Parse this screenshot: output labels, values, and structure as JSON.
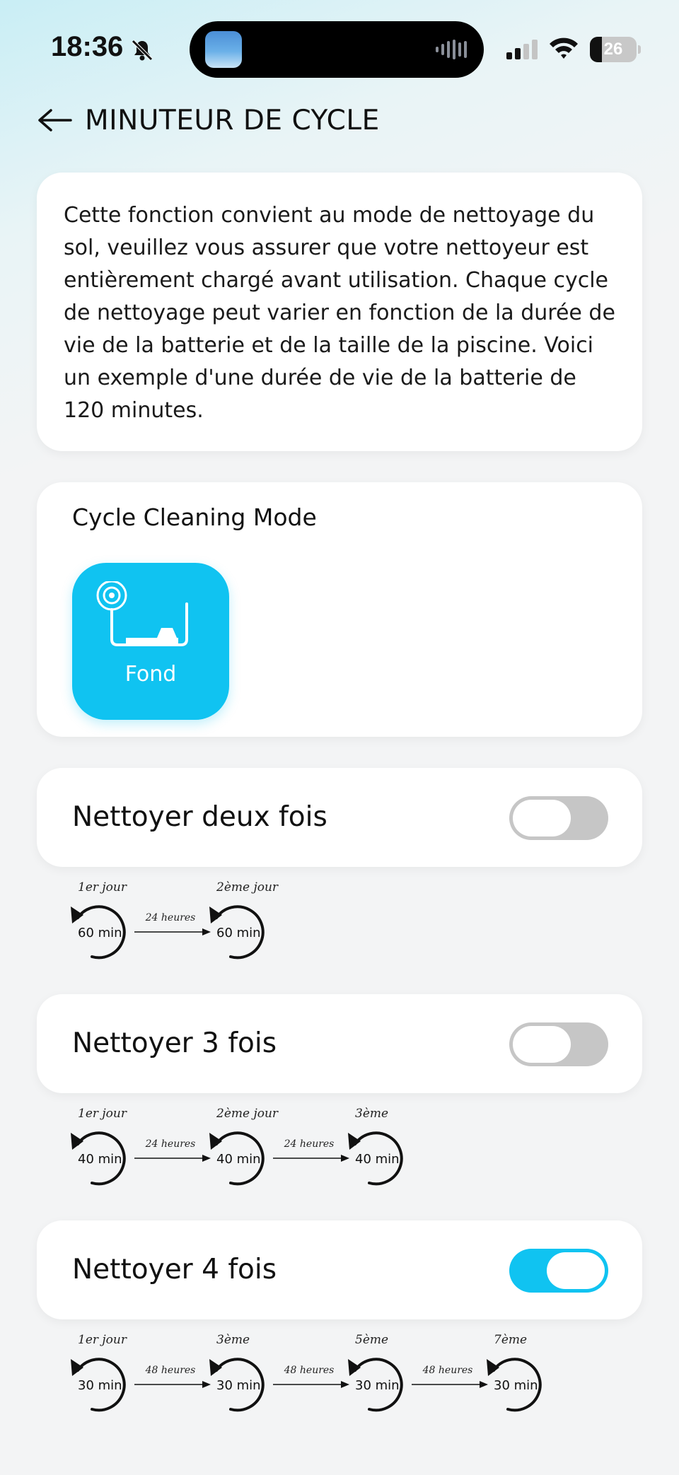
{
  "status_bar": {
    "time": "18:36",
    "battery": "26",
    "battery_level": 0.26
  },
  "header": {
    "title": "MINUTEUR DE CYCLE"
  },
  "info": {
    "text": "Cette fonction convient au mode de nettoyage du sol, veuillez vous assurer que votre nettoyeur est entièrement chargé avant utilisation. Chaque cycle de nettoyage peut varier en fonction de la durée de vie de la batterie et de la taille de la piscine. Voici un exemple d'une durée de vie de la batterie de 120 minutes."
  },
  "mode": {
    "title": "Cycle Cleaning Mode",
    "tile_label": "Fond",
    "tile_color": "#10c3f1"
  },
  "options": [
    {
      "label": "Nettoyer deux fois",
      "enabled": false,
      "steps": [
        {
          "day": "1er jour",
          "duration": "60 min."
        },
        {
          "day": "2ème jour",
          "duration": "60 min."
        }
      ],
      "intervals": [
        "24 heures"
      ]
    },
    {
      "label": "Nettoyer 3 fois",
      "enabled": false,
      "steps": [
        {
          "day": "1er jour",
          "duration": "40 min."
        },
        {
          "day": "2ème jour",
          "duration": "40 min."
        },
        {
          "day": "3ème",
          "duration": "40 min."
        }
      ],
      "intervals": [
        "24 heures",
        "24 heures"
      ]
    },
    {
      "label": "Nettoyer 4 fois",
      "enabled": true,
      "steps": [
        {
          "day": "1er jour",
          "duration": "30 min."
        },
        {
          "day": "3ème",
          "duration": "30 min."
        },
        {
          "day": "5ème",
          "duration": "30 min."
        },
        {
          "day": "7ème",
          "duration": "30 min."
        }
      ],
      "intervals": [
        "48 heures",
        "48 heures",
        "48 heures"
      ]
    }
  ],
  "colors": {
    "accent": "#10c3f1",
    "toggle_off": "#c6c6c6"
  }
}
